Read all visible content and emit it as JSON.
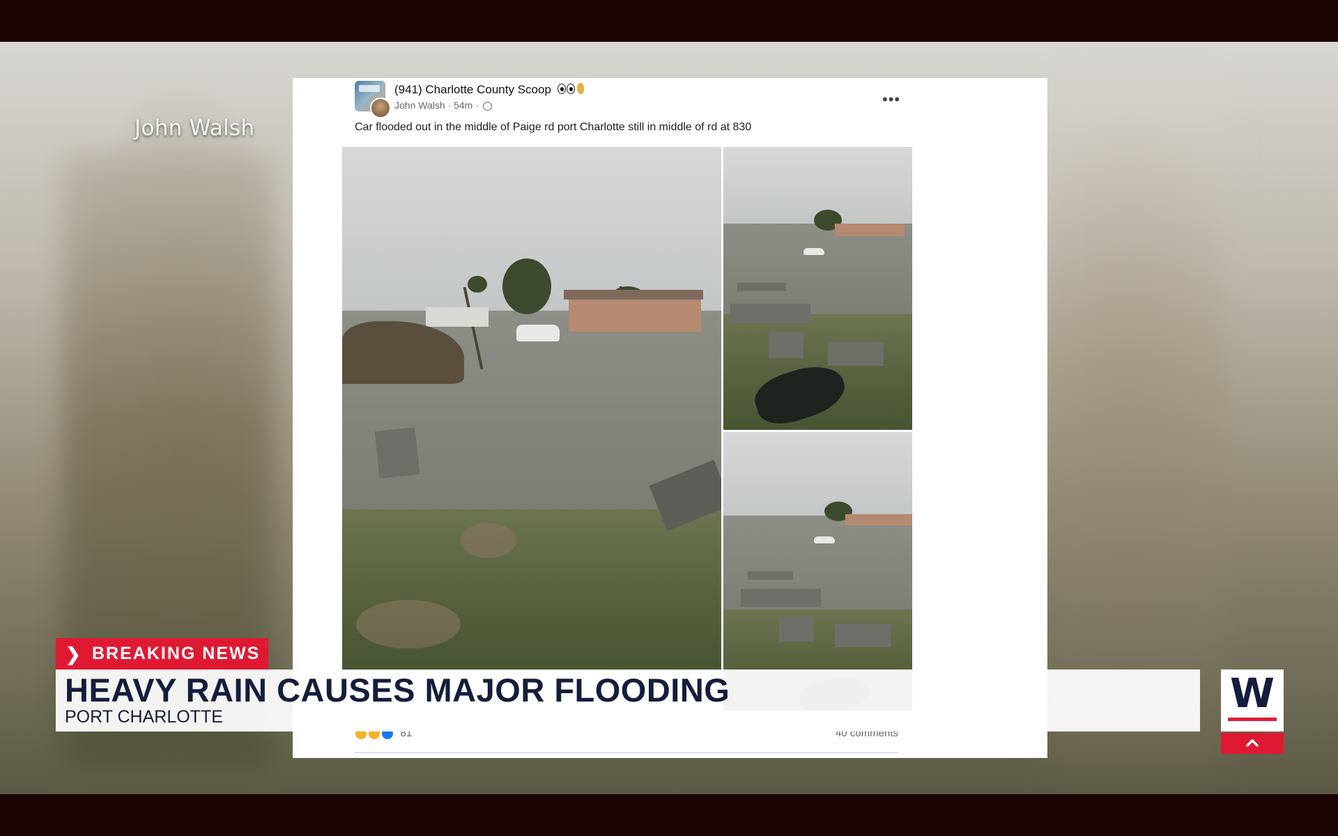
{
  "video": {
    "credit": "John Walsh"
  },
  "post": {
    "group_name": "(941) Charlotte County Scoop",
    "author": "John Walsh",
    "time": "54m",
    "caption": "Car flooded out in the middle of Paige rd port Charlotte still in middle of rd at 830",
    "more_icon": "more-options-icon",
    "reaction_count": "81",
    "comments": "40 comments"
  },
  "lower_third": {
    "tag": "BREAKING NEWS",
    "headline": "HEAVY RAIN CAUSES MAJOR FLOODING",
    "location": "PORT CHARLOTTE",
    "logo_letter": "W"
  },
  "colors": {
    "breaking_red": "#e01933",
    "headline_navy": "#151d3d",
    "letterbox": "#1c0304"
  }
}
